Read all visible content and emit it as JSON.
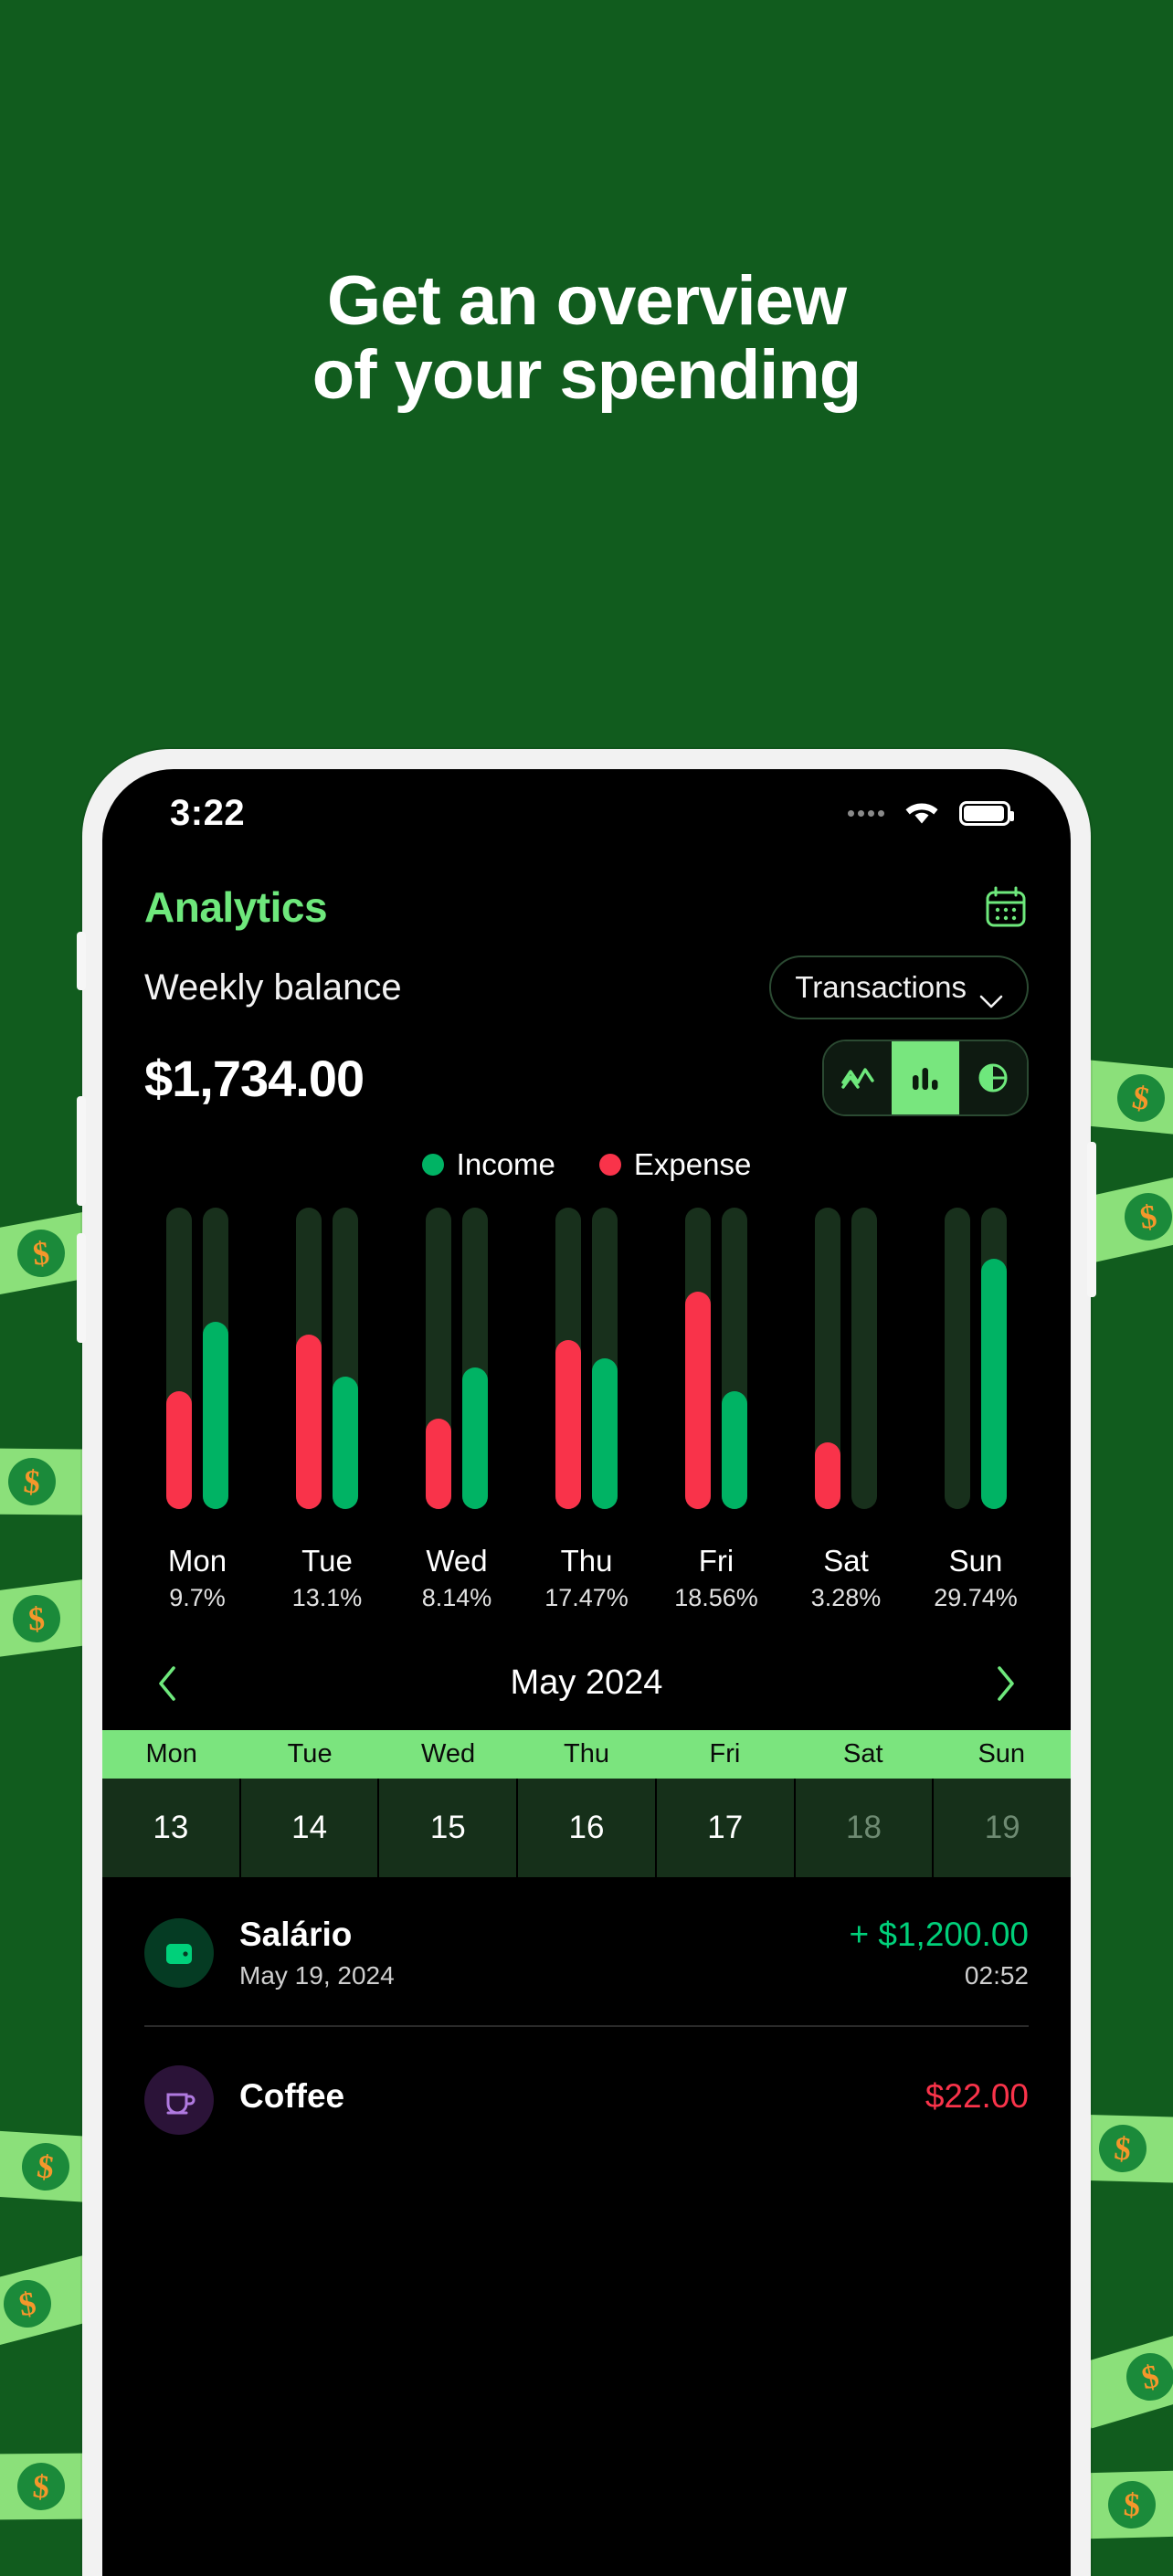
{
  "promo": {
    "headline_line1": "Get an overview",
    "headline_line2": "of your spending",
    "background_color": "#115C1E"
  },
  "status_bar": {
    "time": "3:22",
    "wifi_icon": "wifi-icon",
    "battery_icon": "battery-icon",
    "signal_icon": "signal-dots-icon"
  },
  "app": {
    "title": "Analytics",
    "calendar_icon": "calendar-icon",
    "section_label": "Weekly balance",
    "filter": {
      "label": "Transactions",
      "chevron_icon": "chevron-down-icon"
    },
    "balance": "$1,734.00",
    "chart_type_toggle": {
      "options": [
        "line-chart-icon",
        "bar-chart-icon",
        "pie-chart-icon"
      ],
      "selected_index": 1,
      "active_color": "#78E67E"
    },
    "legend": [
      {
        "label": "Income",
        "color": "#00B364"
      },
      {
        "label": "Expense",
        "color": "#F9334A"
      }
    ],
    "month_nav": {
      "prev_icon": "chevron-left-icon",
      "label": "May 2024",
      "next_icon": "chevron-right-icon",
      "arrow_color": "#6EE87C"
    },
    "week_strip": {
      "weekday_headers": [
        "Mon",
        "Tue",
        "Wed",
        "Thu",
        "Fri",
        "Sat",
        "Sun"
      ],
      "days": [
        {
          "number": "13",
          "dim": false
        },
        {
          "number": "14",
          "dim": false
        },
        {
          "number": "15",
          "dim": false
        },
        {
          "number": "16",
          "dim": false
        },
        {
          "number": "17",
          "dim": false
        },
        {
          "number": "18",
          "dim": true
        },
        {
          "number": "19",
          "dim": true
        }
      ],
      "header_bg": "#7BE47E",
      "cell_bg": "#16301A"
    },
    "transactions": [
      {
        "name": "Salário",
        "date": "May 19, 2024",
        "amount": "+ $1,200.00",
        "time": "02:52",
        "sign": "pos",
        "icon": "wallet-icon",
        "icon_bg": "#053B23",
        "icon_color": "#00D07A"
      },
      {
        "name": "Coffee",
        "date": "",
        "amount": "$22.00",
        "time": "",
        "sign": "neg",
        "icon": "coffee-icon",
        "icon_bg": "#2B1338",
        "icon_color": "#B07AE0"
      }
    ]
  },
  "chart_data": {
    "type": "bar",
    "title": "Weekly balance",
    "categories": [
      "Mon",
      "Tue",
      "Wed",
      "Thu",
      "Fri",
      "Sat",
      "Sun"
    ],
    "category_percents": [
      "9.7%",
      "13.1%",
      "8.14%",
      "17.47%",
      "18.56%",
      "3.28%",
      "29.74%"
    ],
    "series": [
      {
        "name": "Expense",
        "color": "#F9334A",
        "values": [
          39,
          58,
          30,
          56,
          72,
          22,
          0
        ]
      },
      {
        "name": "Income",
        "color": "#00B364",
        "values": [
          62,
          44,
          47,
          50,
          39,
          0,
          83
        ]
      }
    ],
    "ylim": [
      0,
      100
    ],
    "grid": false,
    "legend_position": "top",
    "xlabel": "",
    "ylabel": ""
  }
}
